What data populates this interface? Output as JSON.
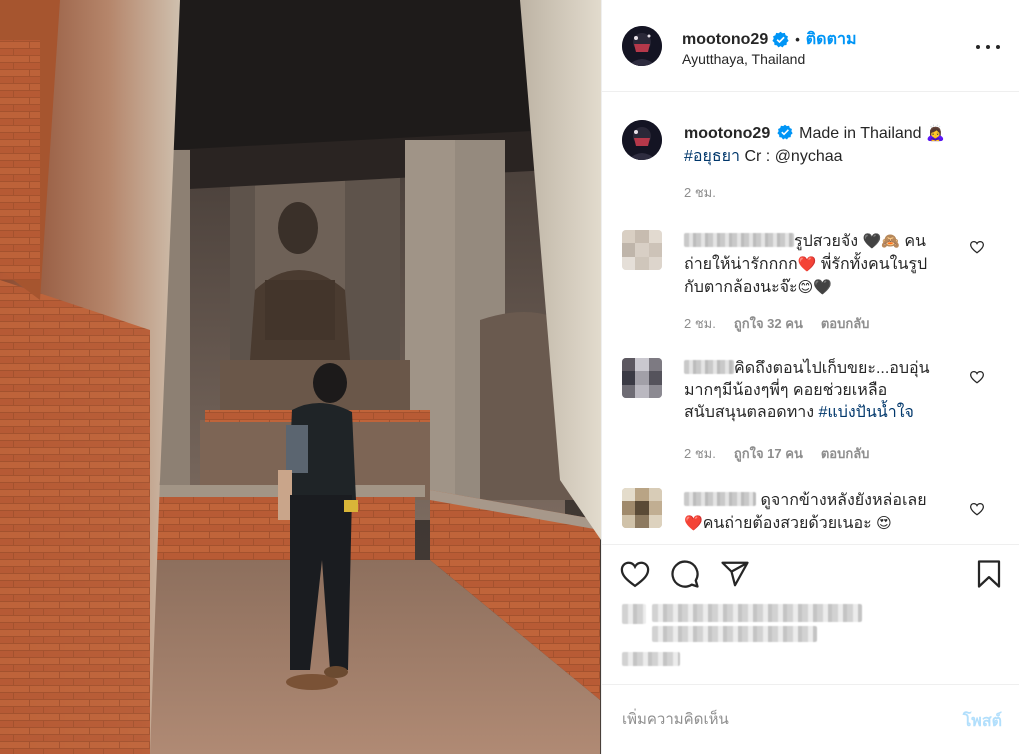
{
  "post": {
    "username": "mootono29",
    "location": "Ayutthaya, Thailand",
    "follow_label": "ติดตาม",
    "separator": "•",
    "verified_color": "#0095f6"
  },
  "caption": {
    "username": "mootono29",
    "text": "Made in Thailand",
    "emoji": "🙇‍♀️",
    "hashtag": "#อยุธยา",
    "credit": "Cr : @nychaa",
    "time": "2 ชม."
  },
  "comments": [
    {
      "text_line1": "รูปสวยจัง",
      "emoji1": "🖤🙈",
      "text_rest1": "คน",
      "line2": "ถ่ายให้น่ารักกกก",
      "emoji2": "❤️",
      "line2b": "พี่รักทั้งคนในรูป",
      "line3": "กับตากล้องนะจ๊ะ",
      "emoji3": "😊🖤",
      "time": "2 ชม.",
      "likes": "ถูกใจ 32 คน",
      "reply": "ตอบกลับ"
    },
    {
      "line1": "คิดถึงตอนไปเก็บขยะ...อบอุ่น",
      "line2": "มากๆมีน้องๆพี่ๆ คอยช่วยเหลือ",
      "line3": "สนับสนุนตลอดทาง",
      "hashtag": "#แบ่งปันน้ำใจ",
      "time": "2 ชม.",
      "likes": "ถูกใจ 17 คน",
      "reply": "ตอบกลับ"
    },
    {
      "line1": "ดูจากข้างหลังยังหล่อเลย",
      "emoji1": "❤️",
      "line2": "คนถ่ายต้องสวยด้วยเนอะ",
      "emoji2": "😍"
    }
  ],
  "add_comment": {
    "placeholder": "เพิ่มความคิดเห็น",
    "post_label": "โพสต์"
  },
  "icons": [
    "heart-icon",
    "comment-icon",
    "share-icon",
    "save-icon",
    "more-icon",
    "verified-icon"
  ]
}
